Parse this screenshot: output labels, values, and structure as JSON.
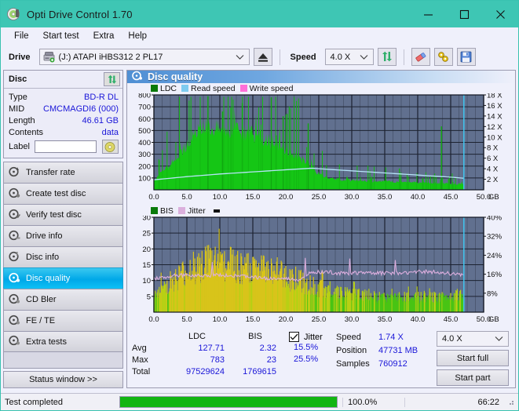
{
  "window": {
    "title": "Opti Drive Control 1.70",
    "icon": "disc-icon",
    "minimize": "minimize-icon",
    "maximize": "maximize-icon",
    "close": "close-icon",
    "titlebar_color": "#3ec6b4"
  },
  "menu": {
    "items": [
      "File",
      "Start test",
      "Extra",
      "Help"
    ]
  },
  "toolbar": {
    "drive_label": "Drive",
    "drive_value": "(J:)  ATAPI iHBS312   2 PL17",
    "eject_icon": "eject-icon",
    "speed_label": "Speed",
    "speed_value": "4.0 X",
    "refresh_icon": "refresh-icon",
    "erase_icon": "eraser-icon",
    "tools_icon": "tools-icon",
    "save_icon": "save-icon"
  },
  "disc_panel": {
    "title": "Disc",
    "refresh_icon": "refresh-icon",
    "label_icon": "disc-label-icon",
    "rows": [
      {
        "key": "Type",
        "value": "BD-R DL"
      },
      {
        "key": "MID",
        "value": "CMCMAGDI6 (000)"
      },
      {
        "key": "Length",
        "value": "46.61 GB"
      },
      {
        "key": "Contents",
        "value": "data"
      }
    ],
    "label_key": "Label",
    "label_value": "",
    "label_placeholder": ""
  },
  "nav": {
    "items": [
      {
        "label": "Transfer rate",
        "icon": "disc-test-icon",
        "selected": false
      },
      {
        "label": "Create test disc",
        "icon": "disc-create-icon",
        "selected": false
      },
      {
        "label": "Verify test disc",
        "icon": "disc-verify-icon",
        "selected": false
      },
      {
        "label": "Drive info",
        "icon": "drive-info-icon",
        "selected": false
      },
      {
        "label": "Disc info",
        "icon": "disc-info-icon",
        "selected": false
      },
      {
        "label": "Disc quality",
        "icon": "disc-quality-icon",
        "selected": true
      },
      {
        "label": "CD Bler",
        "icon": "cd-bler-icon",
        "selected": false
      },
      {
        "label": "FE / TE",
        "icon": "fe-te-icon",
        "selected": false
      },
      {
        "label": "Extra tests",
        "icon": "extra-tests-icon",
        "selected": false
      }
    ],
    "status_window": "Status window >>"
  },
  "content": {
    "header_title": "Disc quality",
    "header_icon": "disc-quality-icon"
  },
  "chart_data": [
    {
      "type": "area",
      "id": "ldc-chart",
      "title": "Disc quality",
      "xlabel": "GB",
      "ylabel": "",
      "xlim": [
        0,
        50
      ],
      "ylim": [
        0,
        800
      ],
      "y2lim": [
        0,
        18
      ],
      "grid": true,
      "legend_position": "top-left",
      "legend": [
        {
          "name": "LDC",
          "color": "#0a7a0a"
        },
        {
          "name": "Read speed",
          "color": "#7ecbf0"
        },
        {
          "name": "Write speed",
          "color": "#ff6fd8"
        }
      ],
      "xticks": [
        "0.0",
        "5.0",
        "10.0",
        "15.0",
        "20.0",
        "25.0",
        "30.0",
        "35.0",
        "40.0",
        "45.0",
        "50.0"
      ],
      "yticks": [
        "100",
        "200",
        "300",
        "400",
        "500",
        "600",
        "700",
        "800"
      ],
      "y2ticks": [
        "2 X",
        "4 X",
        "6 X",
        "8 X",
        "10 X",
        "12 X",
        "14 X",
        "16 X",
        "18 X"
      ],
      "series": [
        {
          "name": "LDC",
          "color": "#16c416",
          "x": [
            0,
            1,
            2,
            3,
            4,
            5,
            6,
            7,
            8,
            9,
            10,
            11,
            12,
            13,
            14,
            15,
            16,
            17,
            18,
            19,
            20,
            21,
            22,
            23,
            24,
            25,
            26,
            27,
            28,
            29,
            30,
            31,
            32,
            33,
            34,
            35,
            36,
            37,
            38,
            39,
            40,
            41,
            42,
            43,
            44,
            45,
            46,
            47
          ],
          "values": [
            80,
            150,
            200,
            250,
            320,
            400,
            470,
            530,
            560,
            560,
            545,
            540,
            530,
            520,
            505,
            490,
            470,
            440,
            420,
            390,
            360,
            330,
            290,
            250,
            190,
            140,
            110,
            100,
            95,
            90,
            85,
            80,
            80,
            78,
            75,
            75,
            72,
            70,
            70,
            68,
            65,
            65,
            62,
            60,
            58,
            55,
            52,
            50
          ]
        },
        {
          "name": "Read speed",
          "color": "#9fdcf7",
          "x": [
            0,
            5,
            10,
            15,
            20,
            24,
            25,
            30,
            35,
            40,
            45,
            47
          ],
          "values": [
            1.9,
            2.5,
            3.0,
            3.4,
            3.8,
            4.1,
            4.0,
            3.6,
            3.2,
            2.8,
            2.4,
            2.2
          ]
        }
      ],
      "peak_markers": [
        {
          "x": 8.2,
          "y": 790
        },
        {
          "x": 10.4,
          "y": 660
        },
        {
          "x": 13.4,
          "y": 730
        },
        {
          "x": 17.8,
          "y": 780
        },
        {
          "x": 19.6,
          "y": 620
        },
        {
          "x": 23.4,
          "y": 560
        },
        {
          "x": 43.6,
          "y": 535
        }
      ],
      "cursor_line_x": 47.0,
      "cursor_color": "#3ecbf5"
    },
    {
      "type": "area",
      "id": "bis-jitter-chart",
      "xlabel": "GB",
      "xlim": [
        0,
        50
      ],
      "ylim": [
        0,
        30
      ],
      "y2lim": [
        0,
        40
      ],
      "grid": true,
      "legend_position": "top-left",
      "legend": [
        {
          "name": "BIS",
          "color": "#0a7a0a"
        },
        {
          "name": "Jitter",
          "color": "#dbb0dd"
        }
      ],
      "xticks": [
        "0.0",
        "5.0",
        "10.0",
        "15.0",
        "20.0",
        "25.0",
        "30.0",
        "35.0",
        "40.0",
        "45.0",
        "50.0"
      ],
      "yticks": [
        "5",
        "10",
        "15",
        "20",
        "25",
        "30"
      ],
      "y2ticks": [
        "8%",
        "16%",
        "24%",
        "32%",
        "40%"
      ],
      "series": [
        {
          "name": "BIS",
          "color": "#d4d412",
          "x": [
            0,
            2,
            4,
            6,
            8,
            10,
            12,
            14,
            16,
            18,
            20,
            22,
            24,
            26,
            28,
            30,
            32,
            34,
            36,
            38,
            40,
            42,
            44,
            46,
            47
          ],
          "values": [
            6,
            9,
            12,
            15,
            17,
            17,
            16,
            15,
            14,
            14,
            12,
            11,
            9,
            8,
            7,
            6,
            6,
            5,
            5,
            5,
            5,
            5,
            5,
            6,
            5
          ]
        },
        {
          "name": "Jitter",
          "color": "#dbb0dd",
          "x": [
            0,
            2,
            4,
            6,
            8,
            10,
            12,
            14,
            16,
            18,
            20,
            22,
            24,
            26,
            28,
            30,
            32,
            34,
            36,
            38,
            40,
            42,
            44,
            46,
            47
          ],
          "values": [
            14,
            15,
            15.5,
            15.5,
            15.5,
            15.5,
            15.5,
            15,
            14.5,
            14,
            14,
            13.5,
            17,
            17,
            16.5,
            16.5,
            16.5,
            16.5,
            16.5,
            16.5,
            17,
            17,
            16.5,
            16,
            16
          ]
        }
      ],
      "cursor_line_x": 47.0,
      "cursor_color": "#3ecbf5"
    }
  ],
  "stats": {
    "col_headers": [
      "LDC",
      "BIS"
    ],
    "rows": [
      {
        "label": "Avg",
        "ldc": "127.71",
        "bis": "2.32"
      },
      {
        "label": "Max",
        "ldc": "783",
        "bis": "23"
      },
      {
        "label": "Total",
        "ldc": "97529624",
        "bis": "1769615"
      }
    ],
    "jitter_label": "Jitter",
    "jitter_checked": true,
    "jitter_avg": "15.5%",
    "jitter_max": "25.5%",
    "speed_label": "Speed",
    "speed_value": "1.74 X",
    "position_label": "Position",
    "position_value": "47731 MB",
    "samples_label": "Samples",
    "samples_value": "760912",
    "speed_select": "4.0 X",
    "start_full": "Start full",
    "start_part": "Start part"
  },
  "statusbar": {
    "text": "Test completed",
    "progress_pct": 100,
    "progress_label": "100.0%",
    "elapsed": "66:22"
  }
}
